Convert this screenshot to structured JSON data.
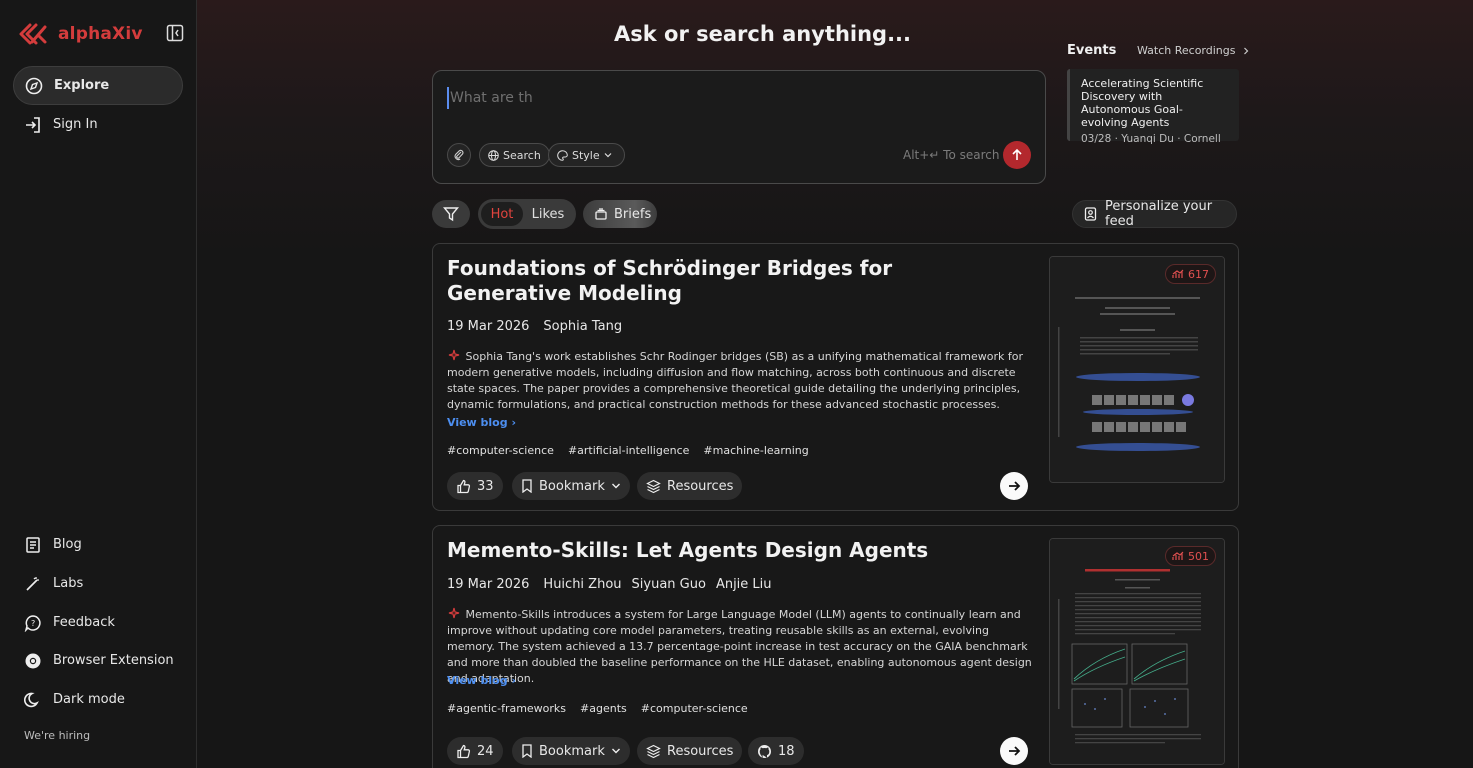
{
  "app": {
    "name": "alphaXiv"
  },
  "sidebar": {
    "items": [
      {
        "label": "Explore",
        "icon": "compass-icon"
      },
      {
        "label": "Sign In",
        "icon": "sign-in-icon"
      }
    ],
    "bottom_items": [
      {
        "label": "Blog",
        "icon": "blog-icon"
      },
      {
        "label": "Labs",
        "icon": "wand-icon"
      },
      {
        "label": "Feedback",
        "icon": "feedback-icon"
      },
      {
        "label": "Browser Extension",
        "icon": "chrome-icon"
      },
      {
        "label": "Dark mode",
        "icon": "moon-icon"
      }
    ],
    "hiring": "We're hiring"
  },
  "search": {
    "title": "Ask or search anything...",
    "placeholder": "What are th",
    "search_label": "Search",
    "style_label": "Style",
    "hint": "Alt+↵ To search"
  },
  "feed_controls": {
    "hot": "Hot",
    "likes": "Likes",
    "briefs": "Briefs",
    "personalize": "Personalize your feed"
  },
  "events": {
    "heading": "Events",
    "watch": "Watch Recordings",
    "items": [
      {
        "title": "Accelerating Scientific Discovery with Autonomous Goal-evolving Agents",
        "meta": "03/28 · Yuanqi Du · Cornell"
      }
    ]
  },
  "papers": [
    {
      "title": "Foundations of Schrödinger Bridges for Generative Modeling",
      "date": "19 Mar 2026",
      "authors": [
        "Sophia Tang"
      ],
      "summary": "Sophia Tang's work establishes Schr Rodinger bridges (SB) as a unifying mathematical framework for modern generative models, including diffusion and flow matching, across both continuous and discrete state spaces. The paper provides a comprehensive theoretical guide detailing the underlying principles, dynamic formulations, and practical construction methods for these advanced stochastic processes.",
      "view_blog": "View blog",
      "tags": [
        "#computer-science",
        "#artificial-intelligence",
        "#machine-learning"
      ],
      "likes": "33",
      "bookmark": "Bookmark",
      "resources": "Resources",
      "views": "617",
      "thumb_title": "Foundations of Schrödinger Bridges for Generative Modeling"
    },
    {
      "title": "Memento-Skills: Let Agents Design Agents",
      "date": "19 Mar 2026",
      "authors": [
        "Huichi Zhou",
        "Siyuan Guo",
        "Anjie Liu"
      ],
      "summary": "Memento-Skills introduces a system for Large Language Model (LLM) agents to continually learn and improve without updating core model parameters, treating reusable skills as an external, evolving memory. The system achieved a 13.7 percentage-point increase in test accuracy on the GAIA benchmark and more than doubled the baseline performance on the HLE dataset, enabling autonomous agent design and adaptation.",
      "view_blog": "View blog",
      "tags": [
        "#agentic-frameworks",
        "#agents",
        "#computer-science"
      ],
      "likes": "24",
      "bookmark": "Bookmark",
      "resources": "Resources",
      "github": "18",
      "views": "501",
      "thumb_title": "Memento-Skills: Let Agents Design Agents"
    }
  ],
  "colors": {
    "accent": "#d43c3c",
    "link": "#4d8ff1",
    "send": "#b3282d"
  }
}
